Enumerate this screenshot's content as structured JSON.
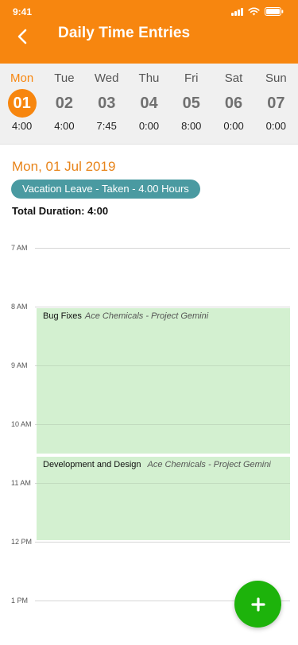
{
  "status_bar": {
    "time": "9:41"
  },
  "header": {
    "title": "Daily Time Entries",
    "back_icon": "chevron-left-icon"
  },
  "week": {
    "days": [
      {
        "name": "Mon",
        "number": "01",
        "hours": "4:00",
        "selected": true
      },
      {
        "name": "Tue",
        "number": "02",
        "hours": "4:00",
        "selected": false
      },
      {
        "name": "Wed",
        "number": "03",
        "hours": "7:45",
        "selected": false
      },
      {
        "name": "Thu",
        "number": "04",
        "hours": "0:00",
        "selected": false
      },
      {
        "name": "Fri",
        "number": "05",
        "hours": "8:00",
        "selected": false
      },
      {
        "name": "Sat",
        "number": "06",
        "hours": "0:00",
        "selected": false
      },
      {
        "name": "Sun",
        "number": "07",
        "hours": "0:00",
        "selected": false
      }
    ]
  },
  "summary": {
    "date": "Mon, 01 Jul 2019",
    "leave": "Vacation Leave - Taken - 4.00 Hours",
    "total": "Total Duration: 4:00"
  },
  "timeline": {
    "hours": [
      "7 AM",
      "8 AM",
      "9 AM",
      "10 AM",
      "11 AM",
      "12 PM",
      "1 PM"
    ],
    "entries": [
      {
        "title": "Bug Fixes",
        "project": "Ace Chemicals - Project Gemini",
        "start": "8:00",
        "end": "10:30"
      },
      {
        "title": "Development and Design",
        "project": "Ace Chemicals - Project Gemini",
        "start": "10:30",
        "end": "12:00"
      }
    ]
  },
  "fab": {
    "label": "+",
    "icon": "plus-icon"
  },
  "colors": {
    "brand": "#F7860F",
    "leave": "#4A9AA1",
    "entry": "#D3F0D0",
    "fab": "#1DB30B"
  }
}
